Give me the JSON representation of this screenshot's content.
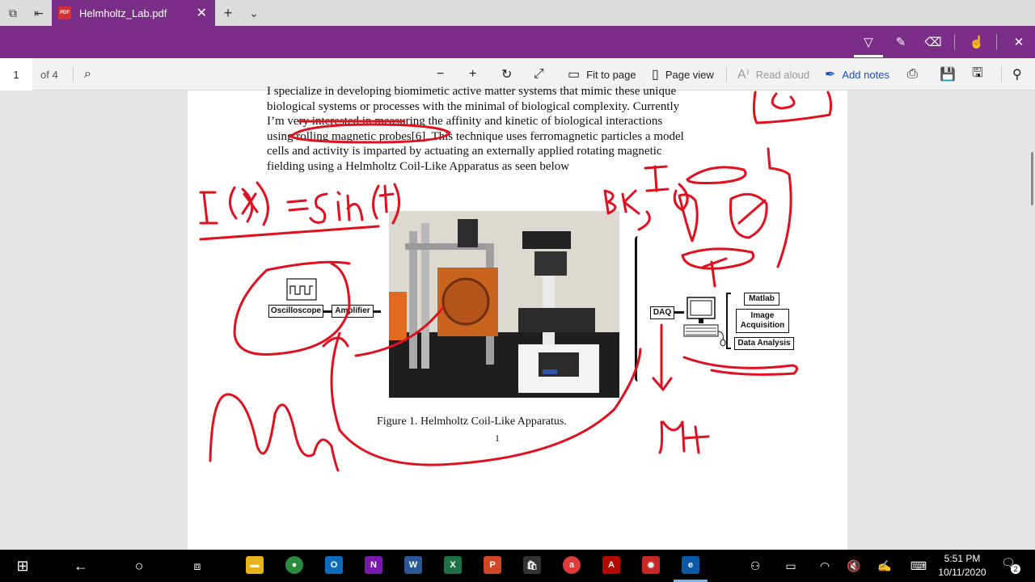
{
  "tabbar": {
    "active_tab_title": "Helmholtz_Lab.pdf",
    "pdf_badge": "PDF"
  },
  "toolbar": {
    "page_current": "1",
    "page_total": "of 4",
    "fit_to_page": "Fit to page",
    "page_view": "Page view",
    "read_aloud": "Read aloud",
    "add_notes": "Add notes"
  },
  "document": {
    "paragraph_lines": [
      "I specialize in developing biomimetic active matter systems that mimic these unique",
      "biological systems or processes with the minimal of biological complexity. Currently",
      "I’m very interested in measuring the affinity and kinetic of biological interactions",
      "using rolling magnetic probes[6]. This technique uses ferromagnetic particles a model",
      "cells and activity is imparted by actuating an externally applied rotating magnetic",
      "fielding using a Helmholtz Coil-Like Apparatus as seen below"
    ],
    "caption": "Figure 1. Helmholtz Coil-Like Apparatus.",
    "page_number": "1",
    "diagram": {
      "oscilloscope": "Oscilloscope",
      "amplifier": "Amplifier",
      "daq": "DAQ",
      "matlab": "Matlab",
      "image_acquisition": "Image Acquisition",
      "data_analysis": "Data Analysis"
    }
  },
  "taskbar": {
    "time": "5:51 PM",
    "date": "10/11/2020",
    "notification_count": "2"
  },
  "colors": {
    "accent": "#7b2e87",
    "ink": "#e0101e"
  }
}
